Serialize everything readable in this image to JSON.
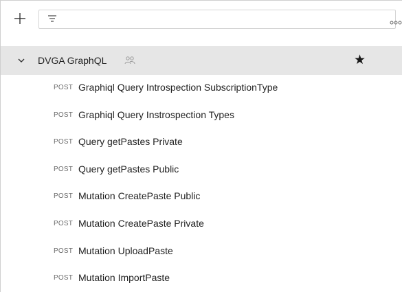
{
  "toolbar": {
    "add_icon": "plus-icon",
    "filter_icon": "filter-icon",
    "filter_placeholder": "",
    "filter_value": "",
    "more_icon": "more-horizontal-icon"
  },
  "collection": {
    "name": "DVGA GraphQL",
    "expand_icon": "chevron-down-icon",
    "shared_icon": "people-icon",
    "favorite_icon": "star-icon",
    "favorite_glyph": "★",
    "requests": [
      {
        "method": "POST",
        "name": "Graphiql Query Introspection SubscriptionType"
      },
      {
        "method": "POST",
        "name": "Graphiql Query Instrospection Types"
      },
      {
        "method": "POST",
        "name": "Query getPastes Private"
      },
      {
        "method": "POST",
        "name": "Query getPastes Public"
      },
      {
        "method": "POST",
        "name": "Mutation CreatePaste Public"
      },
      {
        "method": "POST",
        "name": "Mutation CreatePaste Private"
      },
      {
        "method": "POST",
        "name": "Mutation UploadPaste"
      },
      {
        "method": "POST",
        "name": "Mutation ImportPaste"
      }
    ]
  },
  "colors": {
    "selected_row_bg": "#e6e6e6",
    "method_text": "#6b6b6b",
    "text": "#1f1f1f"
  }
}
